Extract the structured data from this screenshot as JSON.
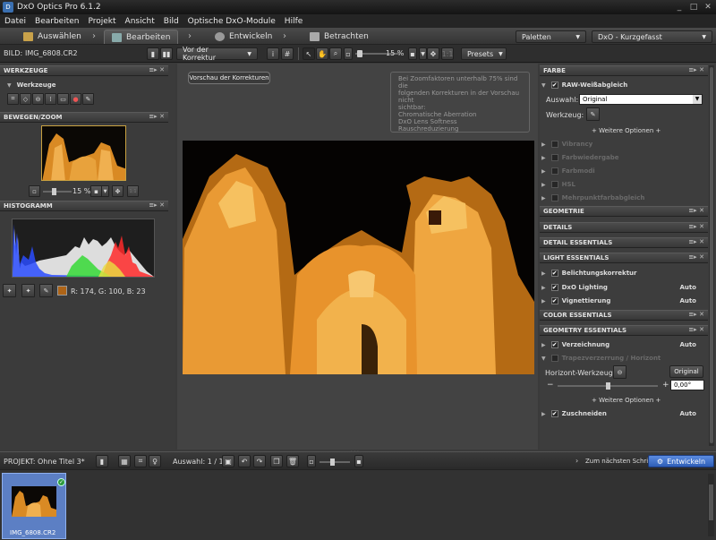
{
  "window": {
    "title": "DxO Optics Pro 6.1.2"
  },
  "menu": [
    "Datei",
    "Bearbeiten",
    "Projekt",
    "Ansicht",
    "Bild",
    "Optische DxO-Module",
    "Hilfe"
  ],
  "workflow_tabs": [
    {
      "label": "Auswählen"
    },
    {
      "label": "Bearbeiten"
    },
    {
      "label": "Entwickeln"
    },
    {
      "label": "Betrachten"
    }
  ],
  "palettes_label": "Paletten",
  "workspace_label": "DxO - Kurzgefasst",
  "toolbar": {
    "bild_label": "BILD:",
    "filename": "IMG_6808.CR2",
    "compare_select": "Vor der Korrektur",
    "zoom": "15 %",
    "presets_label": "Presets"
  },
  "left": {
    "tools_header": "WERKZEUGE",
    "tools_sub": "Werkzeuge",
    "move_header": "BEWEGEN/ZOOM",
    "nav_zoom": "15 %",
    "histogram_header": "HISTOGRAMM",
    "rgb_readout": "R: 174, G: 100, B:  23"
  },
  "viewer": {
    "preview_button": "Vorschau der Korrekturen",
    "warning": [
      "Bei Zoomfaktoren unterhalb 75% sind die",
      "folgenden Korrekturen in der Vorschau nicht",
      "sichtbar:",
      "Chromatische Aberration",
      "DxO Lens Softness",
      "Rauschreduzierung"
    ]
  },
  "right": {
    "farbe_header": "FARBE",
    "raw_wb": "RAW-Weißabgleich",
    "auswahl_label": "Auswahl:",
    "auswahl_value": "Original",
    "werkzeug_label": "Werkzeug:",
    "more_options": "+ Weitere Optionen +",
    "dim_items": [
      "Vibrancy",
      "Farbwiedergabe",
      "Farbmodi",
      "HSL",
      "Mehrpunktfarbabgleich"
    ],
    "geometrie_header": "GEOMETRIE",
    "details_header": "DETAILS",
    "detail_essentials_header": "DETAIL ESSENTIALS",
    "light_essentials_header": "LIGHT ESSENTIALS",
    "light_items": [
      {
        "label": "Belichtungskorrektur",
        "auto": ""
      },
      {
        "label": "DxO Lighting",
        "auto": "Auto"
      },
      {
        "label": "Vignettierung",
        "auto": "Auto"
      }
    ],
    "color_essentials_header": "COLOR ESSENTIALS",
    "geometry_essentials_header": "GEOMETRY ESSENTIALS",
    "verzeichnung": "Verzeichnung",
    "verzeichnung_auto": "Auto",
    "trapez": "Trapezverzerrung / Horizont",
    "horizont_label": "Horizont-Werkzeug:",
    "original_button": "Original",
    "angle_value": "0,00°",
    "more_options2": "+ Weitere Optionen +",
    "zuschneiden": "Zuschneiden",
    "zuschneiden_auto": "Auto"
  },
  "status": {
    "projekt_label": "PROJEKT:",
    "projekt_name": "Ohne Titel 3*",
    "auswahl": "Auswahl: 1 / 1",
    "next_step": "Zum nächsten Schritt",
    "develop_button": "Entwickeln"
  },
  "filmstrip": {
    "thumb_name": "IMG_6808.CR2"
  },
  "colors": {
    "accent_blue": "#3a6fc8",
    "swatch": "#ae6417"
  }
}
